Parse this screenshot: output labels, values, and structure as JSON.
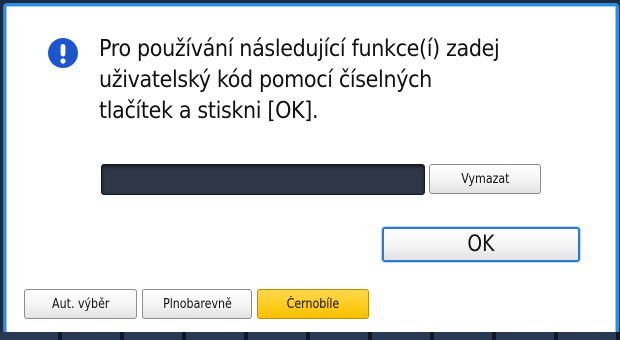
{
  "dialog": {
    "icon": "exclamation-icon",
    "accent_color": "#2b8de0",
    "message_lines": [
      "Pro používání následující funkce(í) zadej",
      "uživatelský kód pomocí číselných",
      "tlačítek a stiskni [OK]."
    ],
    "user_code_value": "",
    "clear_label": "Vymazat",
    "ok_label": "OK"
  },
  "color_modes": {
    "selected_color": "#ffcc1e",
    "selected": "Černobíle",
    "items": [
      {
        "label": "Aut. výběr"
      },
      {
        "label": "Plnobarevně"
      },
      {
        "label": "Černobíle"
      }
    ]
  }
}
